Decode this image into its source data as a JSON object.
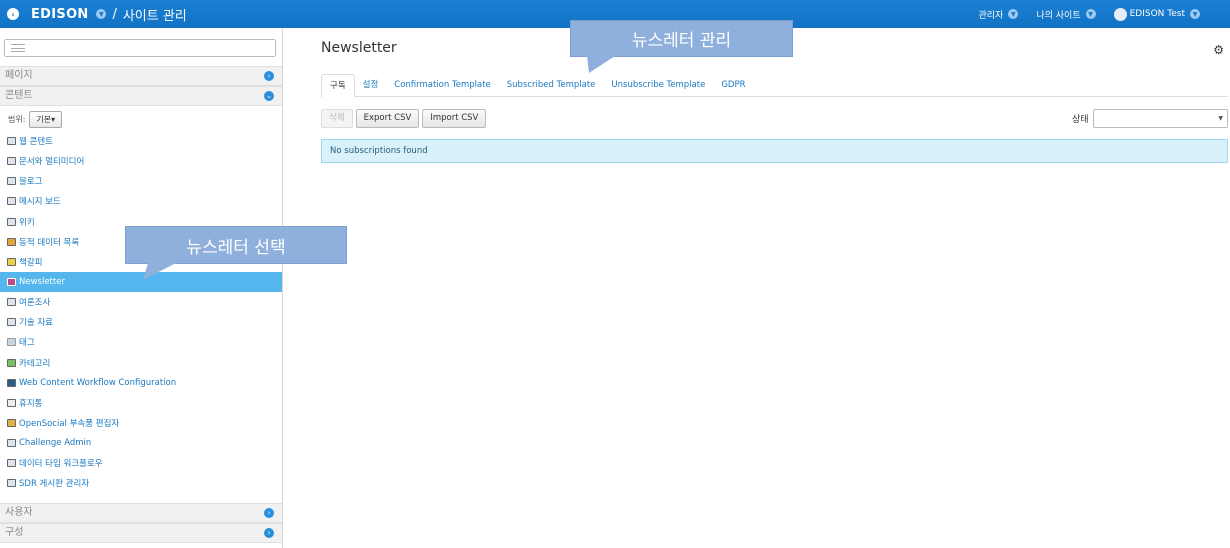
{
  "topbar": {
    "brand": "EDISON",
    "separator": "/",
    "crumb": "사이트 관리",
    "menus": [
      {
        "label": "관리자"
      },
      {
        "label": "나의 사이트"
      }
    ],
    "user": "EDISON Test"
  },
  "sidebar": {
    "panels": {
      "pages": "페이지",
      "content": "콘텐트",
      "users": "사용자",
      "config": "구성"
    },
    "scope_label": "범위:",
    "scope_value": "기본▾",
    "items": [
      {
        "label": "웹 콘텐트"
      },
      {
        "label": "문서와 멀티미디어"
      },
      {
        "label": "블로그"
      },
      {
        "label": "메시지 보드"
      },
      {
        "label": "위키"
      },
      {
        "label": "동적 데이터 목록"
      },
      {
        "label": "책갈피"
      },
      {
        "label": "Newsletter"
      },
      {
        "label": "여론조사"
      },
      {
        "label": "기술 자료"
      },
      {
        "label": "태그"
      },
      {
        "label": "카테고리"
      },
      {
        "label": "Web Content Workflow Configuration"
      },
      {
        "label": "휴지통"
      },
      {
        "label": "OpenSocial 부속품 편집자"
      },
      {
        "label": "Challenge Admin"
      },
      {
        "label": "데이터 타입 워크플로우"
      },
      {
        "label": "SDR 게시판 관리자"
      }
    ]
  },
  "callouts": {
    "manage": "뉴스레터 관리",
    "select": "뉴스레터 선택"
  },
  "main": {
    "title": "Newsletter",
    "tabs": [
      {
        "label": "구독"
      },
      {
        "label": "설정"
      },
      {
        "label": "Confirmation Template"
      },
      {
        "label": "Subscribed Template"
      },
      {
        "label": "Unsubscribe Template"
      },
      {
        "label": "GDPR"
      }
    ],
    "buttons": {
      "delete": "삭제",
      "export": "Export CSV",
      "import": "Import CSV"
    },
    "status_label": "상태",
    "alert": "No subscriptions found"
  }
}
